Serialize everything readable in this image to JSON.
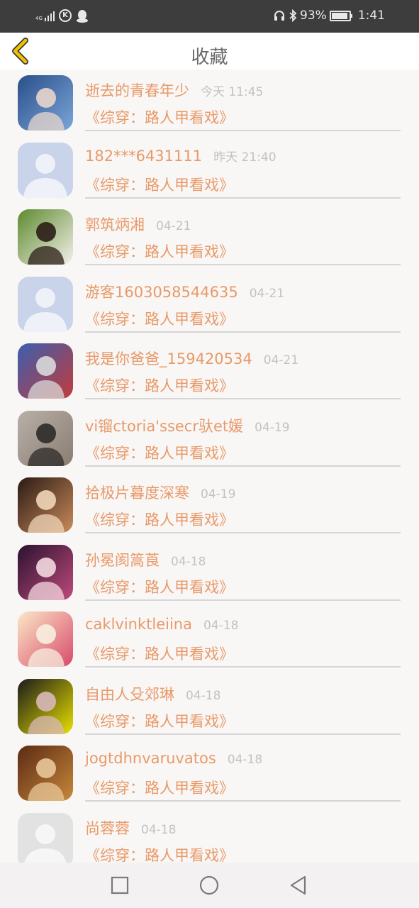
{
  "status_bar": {
    "network_label": "4G",
    "battery": "93%",
    "battery_level": 0.93,
    "time": "1:41",
    "icons": [
      "signal-icon",
      "k-app-icon",
      "qq-icon",
      "headset-icon",
      "bluetooth-icon",
      "battery-icon"
    ]
  },
  "header": {
    "title": "收藏",
    "back_icon": "chevron-left-icon",
    "accent": "#f2c200"
  },
  "items": [
    {
      "name": "逝去的青春年少",
      "time": "今天 11:45",
      "book": "《综穿：路人甲看戏》",
      "avatar": "photo",
      "palette": [
        "#2a4f8a",
        "#7aa6d8",
        "#e8d6cc"
      ]
    },
    {
      "name": "182***6431111",
      "time": "昨天 21:40",
      "book": "《综穿：路人甲看戏》",
      "avatar": "default",
      "palette": [
        "#c9d3ea",
        "#eef1f8",
        "#eef1f8"
      ]
    },
    {
      "name": "郭筑炳湘",
      "time": "04-21",
      "book": "《综穿：路人甲看戏》",
      "avatar": "photo",
      "palette": [
        "#5d8a2e",
        "#f4f0ea",
        "#2b1d16"
      ]
    },
    {
      "name": "游客1603058544635",
      "time": "04-21",
      "book": "《综穿：路人甲看戏》",
      "avatar": "default",
      "palette": [
        "#c9d3ea",
        "#eef1f8",
        "#eef1f8"
      ]
    },
    {
      "name": "我是你爸爸_159420534",
      "time": "04-21",
      "book": "《综穿：路人甲看戏》",
      "avatar": "photo",
      "palette": [
        "#3a5fb0",
        "#c23b3b",
        "#d9d9d9"
      ]
    },
    {
      "name": "vi镏ctoria'ssecr驮et媛",
      "time": "04-19",
      "book": "《综穿：路人甲看戏》",
      "avatar": "photo",
      "palette": [
        "#b8b0a8",
        "#8a7d72",
        "#2d2a28"
      ]
    },
    {
      "name": "拾极片暮度深寒",
      "time": "04-19",
      "book": "《综穿：路人甲看戏》",
      "avatar": "photo",
      "palette": [
        "#2a1a14",
        "#c98b5a",
        "#f0d6b8"
      ]
    },
    {
      "name": "孙冕阂篙莨",
      "time": "04-18",
      "book": "《综穿：路人甲看戏》",
      "avatar": "photo",
      "palette": [
        "#2a1230",
        "#c04a7a",
        "#f3d8e0"
      ]
    },
    {
      "name": "caklvinktleiina",
      "time": "04-18",
      "book": "《综穿：路人甲看戏》",
      "avatar": "photo",
      "palette": [
        "#fbe8c8",
        "#d84a6a",
        "#f7efe0"
      ]
    },
    {
      "name": "自由人殳郊琳",
      "time": "04-18",
      "book": "《综穿：路人甲看戏》",
      "avatar": "photo",
      "palette": [
        "#1a1a1a",
        "#e8e000",
        "#d8b8b8"
      ]
    },
    {
      "name": "jogtdhnvaruvatos",
      "time": "04-18",
      "book": "《综穿：路人甲看戏》",
      "avatar": "photo",
      "palette": [
        "#5a2a14",
        "#c8883a",
        "#e8c89a"
      ]
    },
    {
      "name": "尚蓉蓉",
      "time": "04-18",
      "book": "《综穿：路人甲看戏》",
      "avatar": "default-light",
      "palette": [
        "#e2e2e2",
        "#f6f6f6",
        "#f6f6f6"
      ]
    }
  ],
  "nav": {
    "icons": [
      "recent-apps-icon",
      "home-icon",
      "back-icon"
    ]
  }
}
